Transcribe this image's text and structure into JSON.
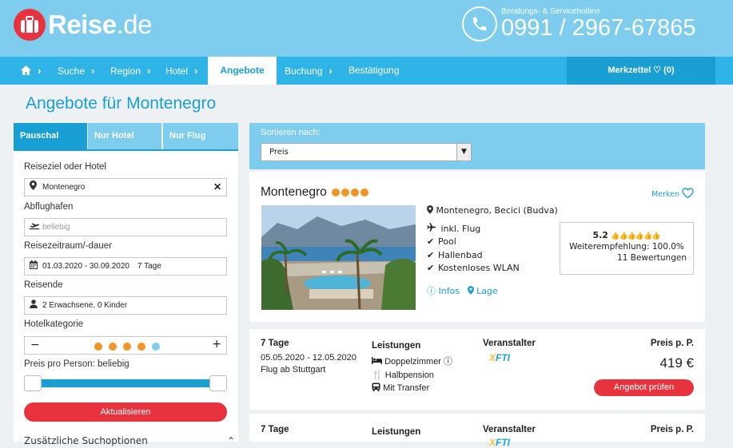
{
  "brand": {
    "name_main": "Reise",
    "name_suffix": ".de"
  },
  "hotline": {
    "label": "Beratungs- & Servicehotline",
    "number": "0991 / 2967-67865"
  },
  "nav": {
    "items": [
      {
        "label": "Suche"
      },
      {
        "label": "Region"
      },
      {
        "label": "Hotel"
      },
      {
        "label": "Angebote",
        "active": true
      },
      {
        "label": "Buchung"
      },
      {
        "label": "Bestätigung"
      }
    ],
    "merkzettel": "Merkzettel ♡ (0)"
  },
  "page_title": "Angebote für Montenegro",
  "tabs": [
    {
      "label": "Pauschal",
      "active": true
    },
    {
      "label": "Nur Hotel"
    },
    {
      "label": "Nur Flug"
    }
  ],
  "form": {
    "destination_label": "Reiseziel oder Hotel",
    "destination_value": "Montenegro",
    "airport_label": "Abflughafen",
    "airport_placeholder": "beliebig",
    "period_label": "Reisezeitraum/-dauer",
    "period_value": "01.03.2020 - 30.09.2020",
    "duration_value": "7 Tage",
    "travellers_label": "Reisende",
    "travellers_value": "2 Erwachsene, 0 Kinder",
    "category_label": "Hotelkategorie",
    "category_selected": 4,
    "category_max": 5,
    "price_label": "Preis pro Person: beliebig",
    "price_range": [
      0,
      1
    ],
    "submit_label": "Aktualisieren",
    "additional_label": "Zusätzliche Suchoptionen"
  },
  "sort": {
    "label": "Sortieren nach:",
    "value": "Preis"
  },
  "hotel": {
    "name": "Montenegro",
    "stars": 4,
    "merken_label": "Merken",
    "location": "Montenegro, Becici (Budva)",
    "features": [
      "inkl. Flug",
      "Pool",
      "Hallenbad",
      "Kostenloses WLAN"
    ],
    "infos_label": "Infos",
    "lage_label": "Lage",
    "rating": {
      "score": "5.2",
      "recommendation": "Weiterempfehlung: 100.0%",
      "reviews": "11 Bewertungen"
    }
  },
  "offers": [
    {
      "duration": "7 Tage",
      "dates": "05.05.2020 - 12.05.2020",
      "flight": "Flug ab Stuttgart",
      "services_label": "Leistungen",
      "services": [
        "Doppelzimmer",
        "Halbpension",
        "Mit Transfer"
      ],
      "operator_label": "Veranstalter",
      "operator": "XFTI",
      "price_label": "Preis p. P.",
      "price": "419 €",
      "button_label": "Angebot prüfen"
    },
    {
      "duration": "7 Tage",
      "services_label": "Leistungen",
      "operator_label": "Veranstalter",
      "operator": "XFTI",
      "price_label": "Preis p. P."
    }
  ],
  "colors": {
    "primary": "#1a9fd4",
    "header": "#7ecdee",
    "nav": "#2eb4e6",
    "accent": "#e8333f",
    "star": "#f39424"
  }
}
